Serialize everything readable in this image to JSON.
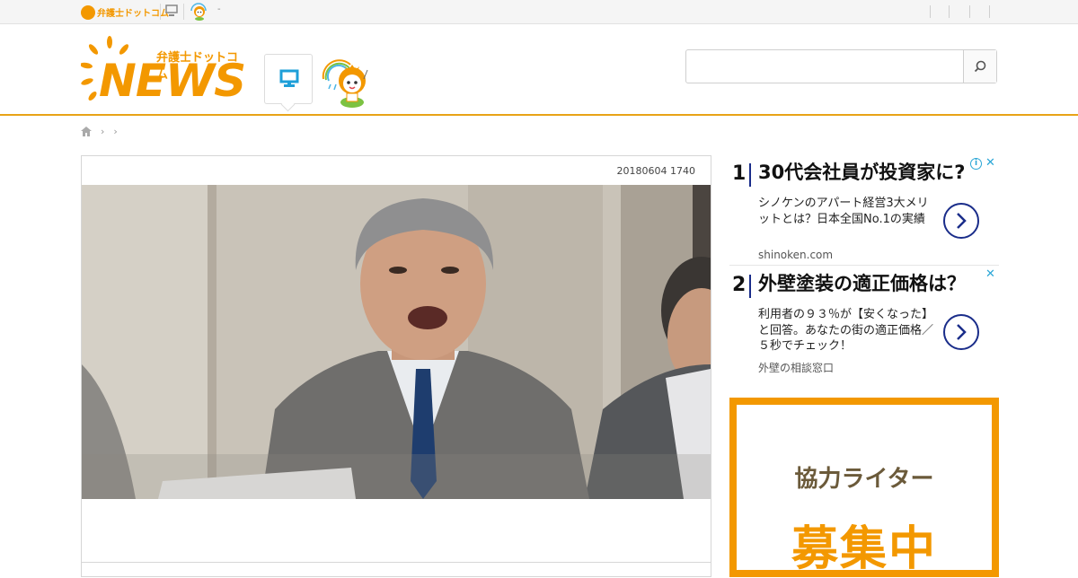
{
  "topbar": {
    "mini_logo_text": "弁護士ドットコム",
    "dash": "-"
  },
  "header": {
    "logo_sub": "弁護士ドットコム",
    "logo_news": "NEWS",
    "search": {
      "placeholder": ""
    }
  },
  "breadcrumb": {
    "sep1": "›",
    "sep2": "›"
  },
  "article": {
    "date": "20180604 1740"
  },
  "ads": [
    {
      "num": "1",
      "headline": "30代会社員が投資家に?",
      "desc": "シノケンのアパート経営3大メリットとは？日本全国No.1の実績",
      "domain": "shinoken.com"
    },
    {
      "num": "2",
      "headline": "外壁塗装の適正価格は？",
      "desc": "利用者の９３％が【安くなった】と回答。あなたの街の適正価格／５秒でチェック！",
      "domain": "外壁の相談窓口"
    }
  ],
  "recruit": {
    "title": "協力ライター",
    "big": "募集中"
  },
  "colors": {
    "brand_orange": "#f39800",
    "header_line": "#e8a317",
    "ad_accent": "#1a2d8a",
    "pc_icon": "#1e9fd8"
  }
}
